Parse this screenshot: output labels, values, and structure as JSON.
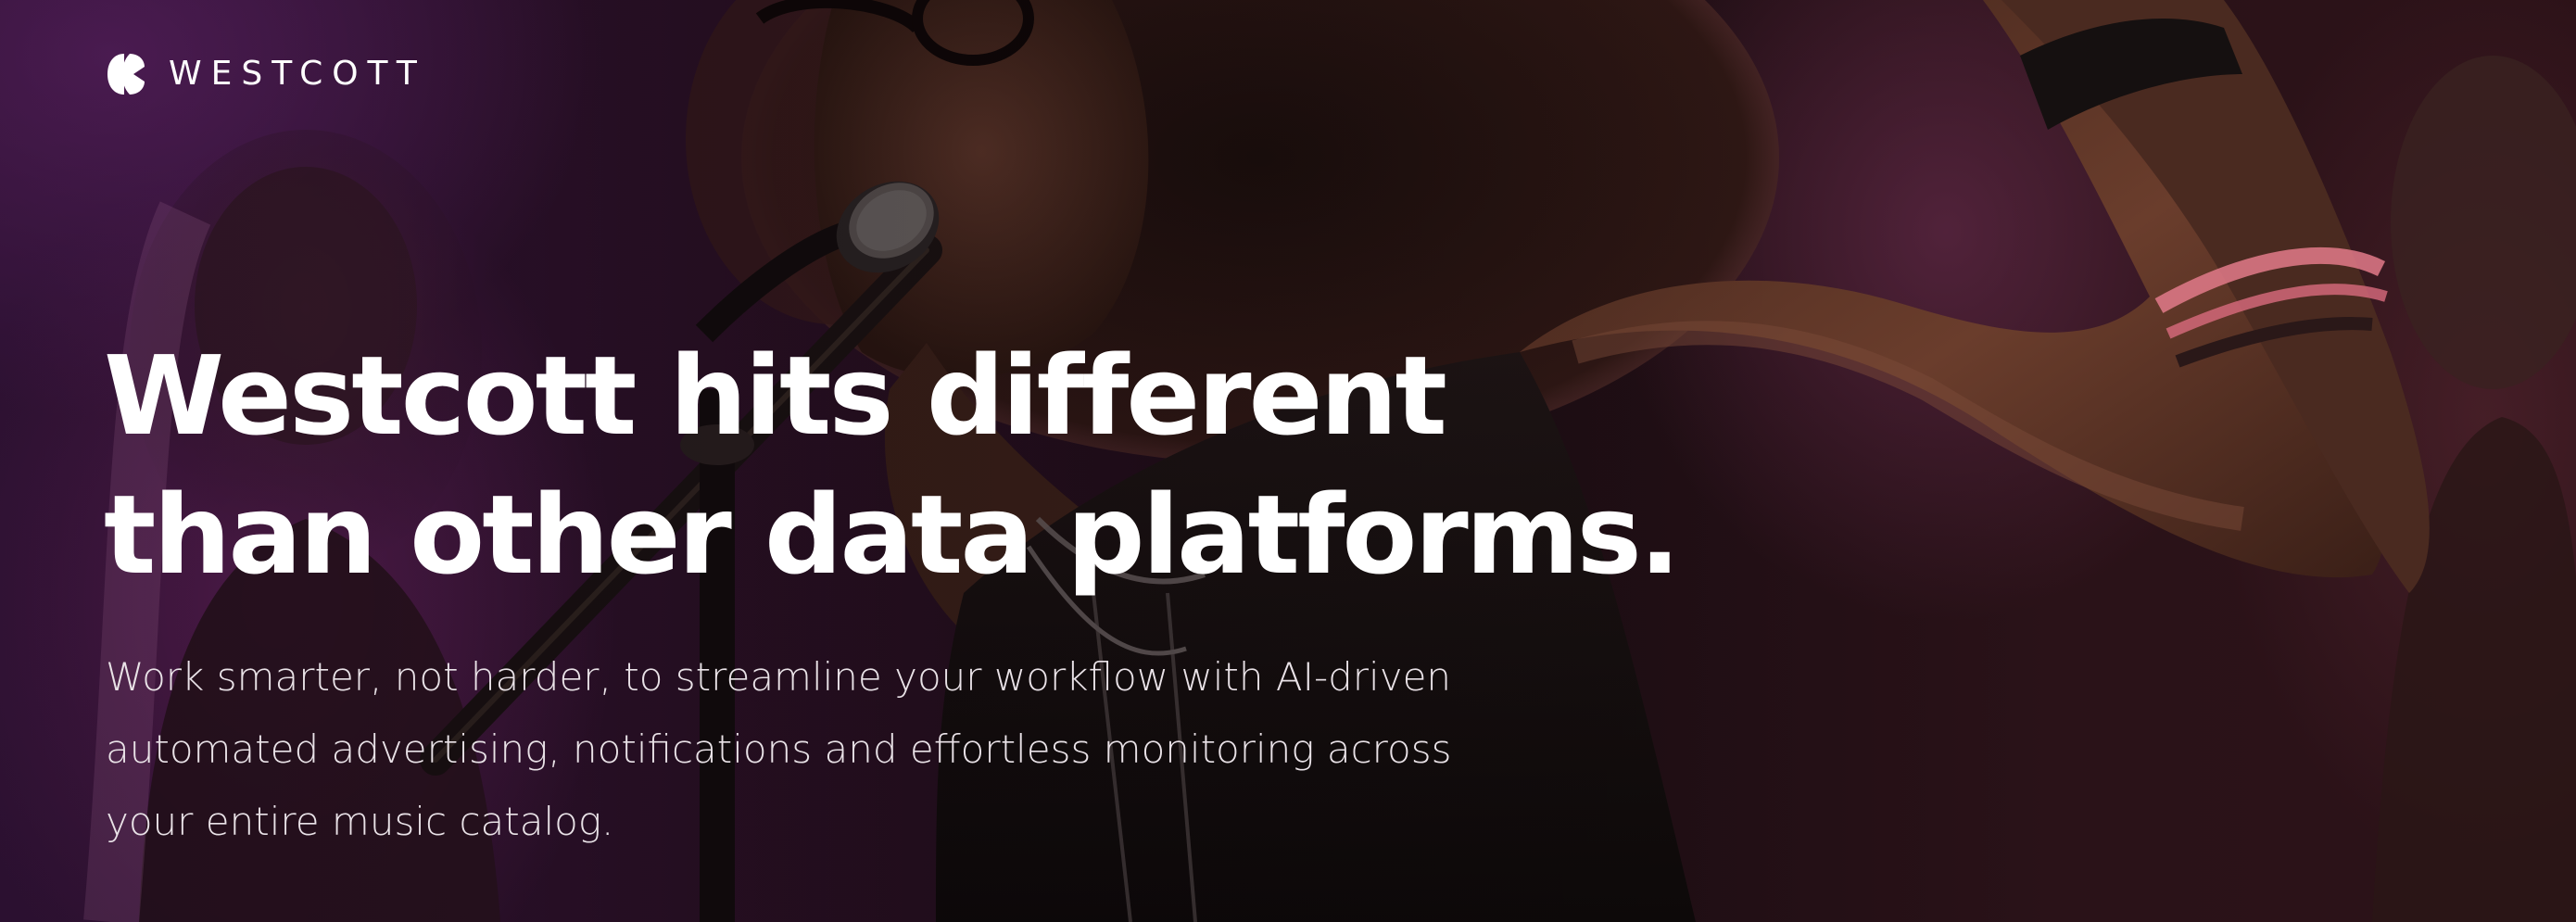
{
  "brand": {
    "name": "WESTCOTT",
    "logo_icon": "westcott-logo-icon"
  },
  "hero": {
    "headline_lines": [
      "Westcott hits different",
      "than other data platforms."
    ],
    "subcopy_lines": [
      "Work smarter, not harder, to streamline your workflow with AI-driven",
      "automated advertising, notifications and effortless monitoring across",
      "your entire music catalog."
    ],
    "background_image": "concert-singer-photo",
    "colors": {
      "text": "#ffffff",
      "accent_purple": "#6e2878",
      "dark": "#140a12"
    }
  }
}
